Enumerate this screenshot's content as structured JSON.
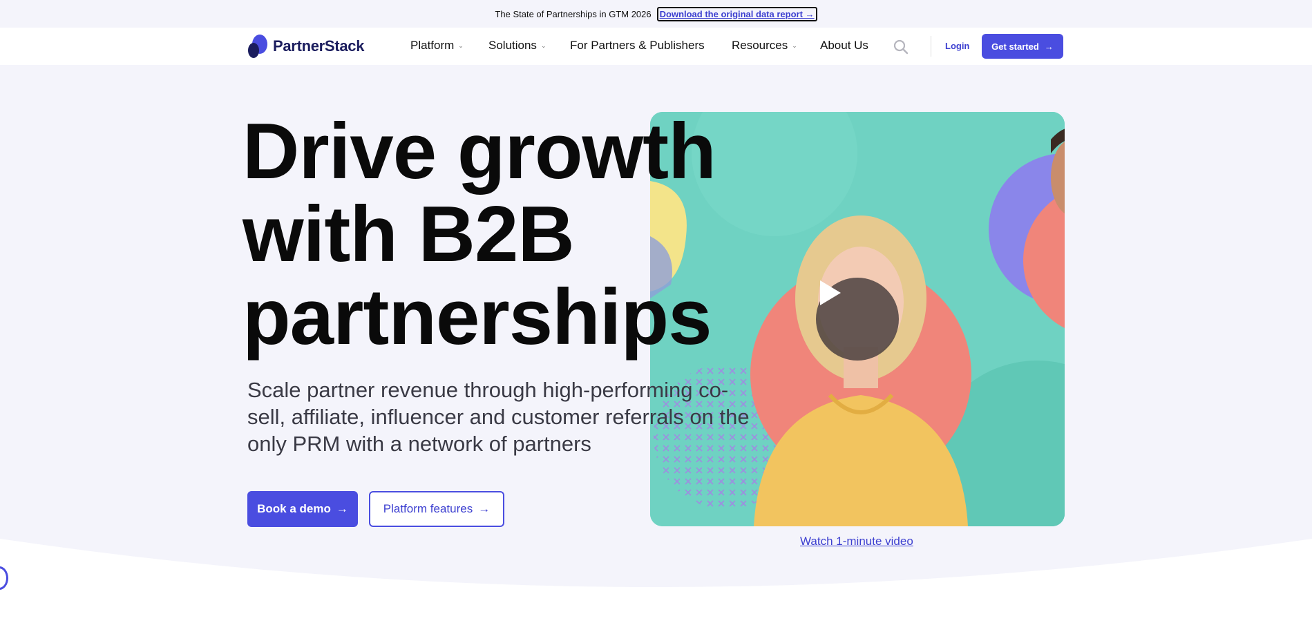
{
  "announcement": {
    "text": "The State of Partnerships in GTM 2026",
    "link_label": "Download the original data report →"
  },
  "nav": {
    "logo_text": "PartnerStack",
    "items": [
      {
        "label": "Platform",
        "has_dropdown": true
      },
      {
        "label": "Solutions",
        "has_dropdown": true
      },
      {
        "label": "For Partners & Publishers",
        "has_dropdown": false
      },
      {
        "label": "Resources",
        "has_dropdown": true
      },
      {
        "label": "About Us",
        "has_dropdown": false
      }
    ],
    "dropdown_glyph": "⌄",
    "login_label": "Login",
    "cta_label": "Get started",
    "arrow": "→"
  },
  "hero": {
    "title_lines": [
      "Drive growth",
      "with B2B",
      "partnerships"
    ],
    "subtitle": "Scale partner revenue through high-performing co-sell, affiliate, influencer and customer referrals on the only PRM with a network of partners",
    "primary_button": "Book a demo",
    "secondary_button": "Platform features",
    "video_link": "Watch 1-minute video"
  },
  "colors": {
    "accent": "#4a4de0",
    "background": "#f4f4fb",
    "video_bg": "#68cfbe"
  },
  "icons": {
    "search": "search-icon",
    "play": "play-icon",
    "arrow": "arrow-right-icon"
  }
}
